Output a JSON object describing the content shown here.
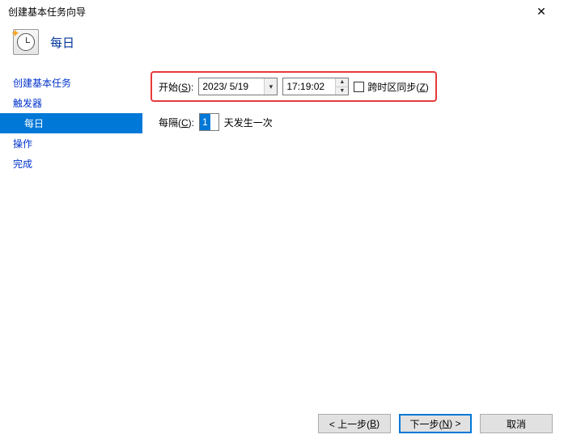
{
  "window_title": "创建基本任务向导",
  "header_title": "每日",
  "sidebar": {
    "items": [
      {
        "label": "创建基本任务"
      },
      {
        "label": "触发器"
      },
      {
        "label": "每日"
      },
      {
        "label": "操作"
      },
      {
        "label": "完成"
      }
    ],
    "selected_index": 2
  },
  "form": {
    "start_label_pre": "开始(",
    "start_label_key": "S",
    "start_label_post": "):",
    "date_value": "2023/ 5/19",
    "time_value": "17:19:02",
    "sync_label_pre": "跨时区同步(",
    "sync_label_key": "Z",
    "sync_label_post": ")",
    "sync_checked": false,
    "every_label_pre": "每隔(",
    "every_label_key": "C",
    "every_label_post": "):",
    "every_value": "1",
    "every_suffix": "天发生一次"
  },
  "buttons": {
    "back_pre": "< 上一步(",
    "back_key": "B",
    "back_post": ")",
    "next_pre": "下一步(",
    "next_key": "N",
    "next_post": ") >",
    "cancel": "取消"
  }
}
